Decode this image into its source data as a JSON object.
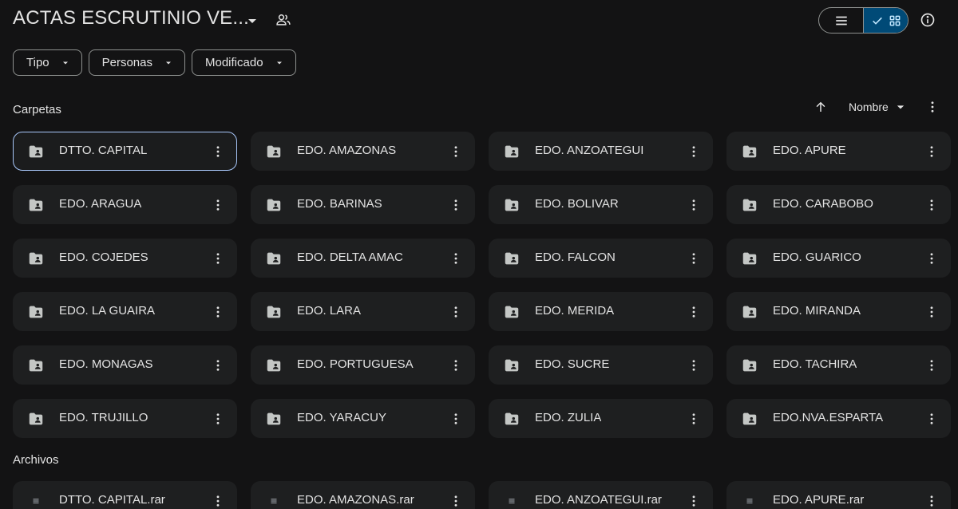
{
  "header": {
    "title": "ACTAS ESCRUTINIO VE...",
    "title_caret_icon": "arrow-drop-down-icon",
    "share_icon": "shared-people-icon",
    "view_list_icon": "list-view-icon",
    "view_grid_icon": "grid-view-icon",
    "view_selected": "grid",
    "info_icon": "info-icon"
  },
  "filters": [
    {
      "label": "Tipo"
    },
    {
      "label": "Personas"
    },
    {
      "label": "Modificado"
    }
  ],
  "folders_section": {
    "label": "Carpetas",
    "sort_label": "Nombre",
    "sort_direction": "ascending"
  },
  "folders": [
    {
      "name": "DTTO. CAPITAL",
      "selected": true
    },
    {
      "name": "EDO. AMAZONAS"
    },
    {
      "name": "EDO. ANZOATEGUI"
    },
    {
      "name": "EDO. APURE"
    },
    {
      "name": "EDO. ARAGUA"
    },
    {
      "name": "EDO. BARINAS"
    },
    {
      "name": "EDO. BOLIVAR"
    },
    {
      "name": "EDO. CARABOBO"
    },
    {
      "name": "EDO. COJEDES"
    },
    {
      "name": "EDO. DELTA AMAC"
    },
    {
      "name": "EDO. FALCON"
    },
    {
      "name": "EDO. GUARICO"
    },
    {
      "name": "EDO. LA GUAIRA"
    },
    {
      "name": "EDO. LARA"
    },
    {
      "name": "EDO. MERIDA"
    },
    {
      "name": "EDO. MIRANDA"
    },
    {
      "name": "EDO. MONAGAS"
    },
    {
      "name": "EDO. PORTUGUESA"
    },
    {
      "name": "EDO. SUCRE"
    },
    {
      "name": "EDO. TACHIRA"
    },
    {
      "name": "EDO. TRUJILLO"
    },
    {
      "name": "EDO. YARACUY"
    },
    {
      "name": "EDO. ZULIA"
    },
    {
      "name": "EDO.NVA.ESPARTA"
    }
  ],
  "files_section": {
    "label": "Archivos"
  },
  "files": [
    {
      "name": "DTTO. CAPITAL.rar"
    },
    {
      "name": "EDO. AMAZONAS.rar"
    },
    {
      "name": "EDO. ANZOATEGUI.rar"
    },
    {
      "name": "EDO. APURE.rar"
    }
  ],
  "colors": {
    "background": "#131314",
    "card": "#1e1f20",
    "text": "#e3e3e3",
    "outline": "#8e918f",
    "selected_outline": "#a8c7fa",
    "toggle_active": "#004a77"
  }
}
